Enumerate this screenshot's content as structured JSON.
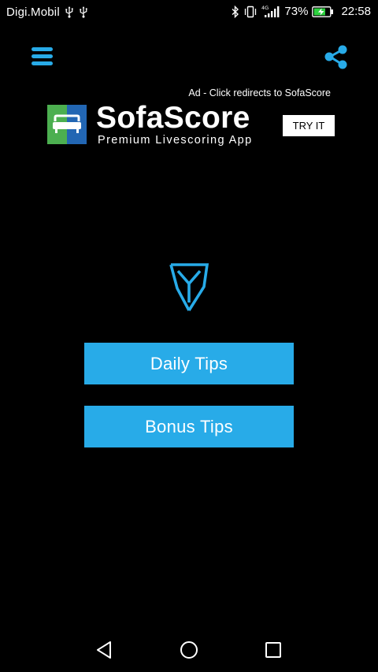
{
  "status_bar": {
    "carrier": "Digi.Mobil",
    "network": "4G",
    "battery_percent": "73%",
    "time": "22:58",
    "icons": [
      "usb-icon",
      "usb-icon",
      "bluetooth-icon",
      "vibrate-icon",
      "signal-icon",
      "battery-charging-icon"
    ]
  },
  "app_bar": {
    "menu_icon": "hamburger-menu-icon",
    "share_icon": "share-icon",
    "accent_color": "#28abe8"
  },
  "ad": {
    "notice": "Ad - Click redirects to SofaScore",
    "brand": "SofaScore",
    "tagline": "Premium Livescoring App",
    "cta": "TRY IT",
    "logo_colors": [
      "#4caf50",
      "#2266b3"
    ]
  },
  "main": {
    "logo_icon": "shield-y-logo-icon",
    "daily_tips_label": "Daily Tips",
    "bonus_tips_label": "Bonus Tips",
    "button_color": "#28abe8"
  },
  "nav_bar": {
    "icons": [
      "back-icon",
      "home-icon",
      "recent-apps-icon"
    ]
  }
}
